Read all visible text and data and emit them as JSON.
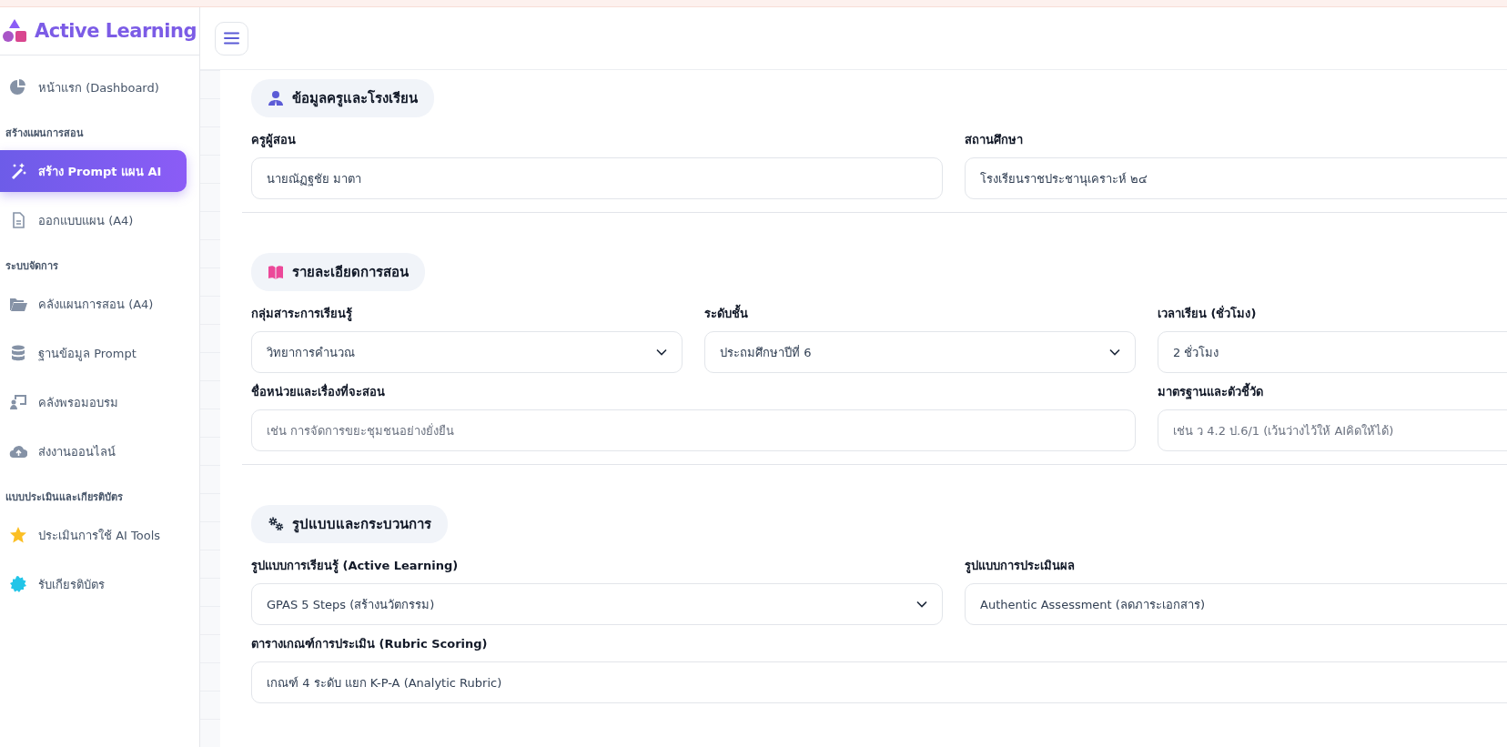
{
  "sidebar": {
    "logo": "Active Learning",
    "items": [
      {
        "kind": "link",
        "label": "หน้าแรก (Dashboard)",
        "selected": false
      },
      {
        "kind": "heading",
        "label": "สร้างแผนการสอน"
      },
      {
        "kind": "link",
        "label": "สร้าง Prompt แผน AI",
        "selected": true
      },
      {
        "kind": "link",
        "label": "ออกแบบแผน (A4)",
        "selected": false
      },
      {
        "kind": "heading",
        "label": "ระบบจัดการ"
      },
      {
        "kind": "link",
        "label": "คลังแผนการสอน (A4)",
        "selected": false
      },
      {
        "kind": "link",
        "label": "ฐานข้อมูล Prompt",
        "selected": false
      },
      {
        "kind": "link",
        "label": "คลังพรอมอบรม",
        "selected": false
      },
      {
        "kind": "link",
        "label": "ส่งงานออนไลน์",
        "selected": false
      },
      {
        "kind": "heading",
        "label": "แบบประเมินและเกียรติบัตร"
      },
      {
        "kind": "link",
        "label": "ประเมินการใช้ AI Tools",
        "selected": false
      },
      {
        "kind": "link",
        "label": "รับเกียรติบัตร",
        "selected": false
      }
    ]
  },
  "sections": [
    {
      "title": "ข้อมูลครูและโรงเรียน",
      "fields": [
        {
          "kind": "text",
          "label": "ครูผู้สอน",
          "value": "นายณัฏฐชัย มาตา"
        },
        {
          "kind": "text",
          "label": "สถานศึกษา",
          "value": "โรงเรียนราชประชานุเคราะห์ ๒๔"
        }
      ]
    },
    {
      "title": "รายละเอียดการสอน",
      "fields": [
        {
          "kind": "select",
          "label": "กลุ่มสาระการเรียนรู้",
          "value": "วิทยาการคำนวณ"
        },
        {
          "kind": "select",
          "label": "ระดับชั้น",
          "value": "ประถมศึกษาปีที่ 6"
        },
        {
          "kind": "text",
          "label": "เวลาเรียน (ชั่วโมง)",
          "value": "2 ชั่วโมง"
        },
        {
          "kind": "text",
          "label": "ชื่อหน่วยและเรื่องที่จะสอน",
          "placeholder": "เช่น การจัดการขยะชุมชนอย่างยั่งยืน"
        },
        {
          "kind": "text",
          "label": "มาตรฐานและตัวชี้วัด",
          "placeholder": "เช่น ว 4.2 ป.6/1 (เว้นว่างไว้ให้ AIคิดให้ได้)"
        }
      ]
    },
    {
      "title": "รูปแบบและกระบวนการ",
      "fields": [
        {
          "kind": "select",
          "label": "รูปแบบการเรียนรู้ (Active Learning)",
          "value": "GPAS 5 Steps (สร้างนวัตกรรม)"
        },
        {
          "kind": "text",
          "label": "รูปแบบการประเมินผล",
          "value": "Authentic Assessment (ลดภาระเอกสาร)"
        },
        {
          "kind": "select",
          "label": "ตารางเกณฑ์การประเมิน (Rubric Scoring)",
          "value": "เกณฑ์ 4 ระดับ แยก K-P-A (Analytic Rubric)"
        }
      ]
    }
  ]
}
